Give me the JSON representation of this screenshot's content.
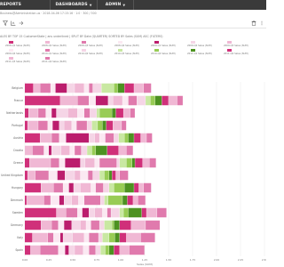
{
  "nav": {
    "reports": "REPORTS",
    "dashboards": "DASHBOARDS",
    "admin": "ADMIN",
    "caret": "▼"
  },
  "breadcrumb": "Business@Administration.us · 2018-04-06 17:15:16 · 1:0 · 300 / 300",
  "toolbar": {
    "icons": [
      "filter-icon",
      "axis-icon",
      "share-icon",
      "delete-icon",
      "more-icon"
    ]
  },
  "chart": {
    "title": "ALES BY TOP 15 CustomerState | ans underlined | SPLIT BY Date (QUARTER) SORTED BY Sales (SUM) ASC (FILTERS)"
  },
  "colors": {
    "c1": "#d0307a",
    "c2": "#e07aad",
    "c3": "#f0b8d4",
    "c4": "#f5d5e6",
    "c5": "#fbe9f2",
    "c6": "#c9e8a2",
    "c7": "#98cc55",
    "c8": "#4d9221",
    "c9": "#bb1d6d",
    "c10": "#eeeeee"
  },
  "chart_data": {
    "type": "bar",
    "orientation": "horizontal",
    "stacked": true,
    "legend_position": "top",
    "grid": true,
    "xlabel": "Sales (SUM)",
    "xlim": [
      0,
      2.5
    ],
    "x_ticks": [
      "0.00",
      "0.25",
      "0.50",
      "0.75",
      "1.00",
      "1.25",
      "1.50",
      "1.75",
      "2.00",
      "2.25",
      "2.50"
    ],
    "categories": [
      "Belgium",
      "France",
      "Netherlands",
      "Portugal",
      "Austria",
      "Croatia",
      "Greece",
      "United Kingdom",
      "Hungary",
      "Denmark",
      "Sweden",
      "Germany",
      "Italy",
      "Spain"
    ],
    "series": [
      {
        "name": "2008-Q1 Sales (SUM)",
        "color": "c1",
        "values": [
          0.09,
          0.37,
          0.04,
          0.03,
          0.16,
          0.0,
          0.05,
          0.03,
          0.17,
          0.02,
          0.33,
          0.17,
          0.08,
          0.06
        ]
      },
      {
        "name": "2008-Q2 Sales (SUM)",
        "color": "c3",
        "values": [
          0.07,
          0.18,
          0.1,
          0.11,
          0.12,
          0.08,
          0.22,
          0.08,
          0.13,
          0.18,
          0.1,
          0.11,
          0.16,
          0.1
        ]
      },
      {
        "name": "2008-Q3 Sales (SUM)",
        "color": "c2",
        "values": [
          0.11,
          0.12,
          0.08,
          0.1,
          0.08,
          0.12,
          0.09,
          0.14,
          0.1,
          0.07,
          0.12,
          0.07,
          0.06,
          0.19
        ]
      },
      {
        "name": "2008-Q4 Sales (SUM)",
        "color": "c5",
        "values": [
          0.05,
          0.07,
          0.06,
          0.05,
          0.07,
          0.05,
          0.06,
          0.09,
          0.06,
          0.09,
          0.05,
          0.06,
          0.07,
          0.07
        ]
      },
      {
        "name": "2009-Q1 Sales (SUM)",
        "color": "c9",
        "values": [
          0.12,
          0.13,
          0.05,
          0.07,
          0.24,
          0.03,
          0.16,
          0.08,
          0.05,
          0.05,
          0.07,
          0.08,
          0.03,
          0.04
        ]
      },
      {
        "name": "2009-Q2 Sales (SUM)",
        "color": "c4",
        "values": [
          0.08,
          0.05,
          0.12,
          0.05,
          0.06,
          0.1,
          0.05,
          0.1,
          0.07,
          0.08,
          0.06,
          0.09,
          0.1,
          0.06
        ]
      },
      {
        "name": "2009-Q3 Sales (SUM)",
        "color": "c3",
        "values": [
          0.1,
          0.1,
          0.1,
          0.08,
          0.05,
          0.09,
          0.1,
          0.06,
          0.11,
          0.07,
          0.08,
          0.06,
          0.12,
          0.09
        ]
      },
      {
        "name": "2009-Q4 Sales (SUM)",
        "color": "c5",
        "values": [
          0.05,
          0.06,
          0.07,
          0.05,
          0.06,
          0.05,
          0.05,
          0.08,
          0.05,
          0.06,
          0.05,
          0.05,
          0.05,
          0.06
        ]
      },
      {
        "name": "2010-Q1 Sales (SUM)",
        "color": "c2",
        "values": [
          0.04,
          0.09,
          0.06,
          0.11,
          0.09,
          0.07,
          0.18,
          0.05,
          0.08,
          0.17,
          0.04,
          0.09,
          0.1,
          0.07
        ]
      },
      {
        "name": "2010-Q2 Sales (SUM)",
        "color": "c4",
        "values": [
          0.09,
          0.09,
          0.07,
          0.05,
          0.05,
          0.06,
          0.03,
          0.07,
          0.06,
          0.04,
          0.09,
          0.05,
          0.04,
          0.05
        ]
      },
      {
        "name": "2010-Q3 Sales (SUM)",
        "color": "c6",
        "values": [
          0.13,
          0.05,
          0.03,
          0.06,
          0.06,
          0.05,
          0.07,
          0.05,
          0.05,
          0.04,
          0.04,
          0.08,
          0.07,
          0.05
        ]
      },
      {
        "name": "2010-Q4 Sales (SUM)",
        "color": "c7",
        "values": [
          0.04,
          0.05,
          0.13,
          0.05,
          0.04,
          0.04,
          0.06,
          0.05,
          0.11,
          0.15,
          0.05,
          0.02,
          0.06,
          0.04
        ]
      },
      {
        "name": "2011-Q1 Sales (SUM)",
        "color": "c8",
        "values": [
          0.07,
          0.07,
          0.04,
          0.04,
          0.06,
          0.12,
          0.03,
          0.03,
          0.1,
          0.05,
          0.14,
          0.06,
          0.05,
          0.05
        ]
      },
      {
        "name": "2011-Q2 Sales (SUM)",
        "color": "c1",
        "values": [
          0.1,
          0.07,
          0.08,
          0.07,
          0.07,
          0.12,
          0.08,
          0.04,
          0.05,
          0.06,
          0.05,
          0.12,
          0.07,
          0.06
        ]
      },
      {
        "name": "2011-Q3 Sales (SUM)",
        "color": "c3",
        "values": [
          0.1,
          0.09,
          0.07,
          0.09,
          0.06,
          0.08,
          0.07,
          0.04,
          0.05,
          0.05,
          0.11,
          0.15,
          0.15,
          0.1
        ]
      },
      {
        "name": "2011-Q4 Sales (SUM)",
        "color": "c2",
        "values": [
          0.08,
          0.06,
          0.05,
          0.05,
          0.06,
          0.07,
          0.07,
          0.09,
          0.08,
          0.08,
          0.1,
          0.15,
          0.15,
          0.16
        ]
      }
    ]
  }
}
